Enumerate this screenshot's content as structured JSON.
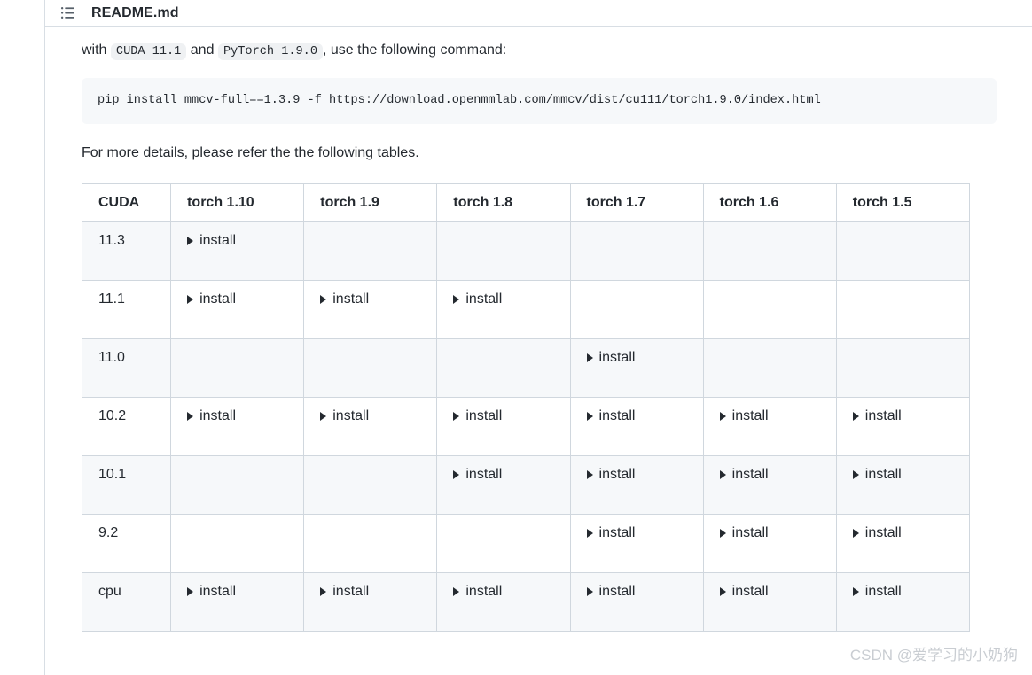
{
  "header": {
    "file_name": "README.md",
    "toc_icon": "list-unordered-icon"
  },
  "content": {
    "intro": {
      "prefix": "with",
      "code_1": "CUDA 11.1",
      "middle": "and",
      "code_2": "PyTorch 1.9.0",
      "suffix": ", use the following command:"
    },
    "command": "pip install mmcv-full==1.3.9 -f https://download.openmmlab.com/mmcv/dist/cu111/torch1.9.0/index.html",
    "details_note": "For more details, please refer the the following tables."
  },
  "table": {
    "headers": [
      "CUDA",
      "torch 1.10",
      "torch 1.9",
      "torch 1.8",
      "torch 1.7",
      "torch 1.6",
      "torch 1.5"
    ],
    "install_label": "install",
    "rows": [
      {
        "cuda": "11.3",
        "cells": [
          "install",
          "",
          "",
          "",
          "",
          ""
        ],
        "shaded": true
      },
      {
        "cuda": "11.1",
        "cells": [
          "install",
          "install",
          "install",
          "",
          "",
          ""
        ],
        "shaded": false
      },
      {
        "cuda": "11.0",
        "cells": [
          "",
          "",
          "",
          "install",
          "",
          ""
        ],
        "shaded": true
      },
      {
        "cuda": "10.2",
        "cells": [
          "install",
          "install",
          "install",
          "install",
          "install",
          "install"
        ],
        "shaded": false
      },
      {
        "cuda": "10.1",
        "cells": [
          "",
          "",
          "install",
          "install",
          "install",
          "install"
        ],
        "shaded": true
      },
      {
        "cuda": "9.2",
        "cells": [
          "",
          "",
          "",
          "install",
          "install",
          "install"
        ],
        "shaded": false
      },
      {
        "cuda": "cpu",
        "cells": [
          "install",
          "install",
          "install",
          "install",
          "install",
          "install"
        ],
        "shaded": true
      }
    ]
  },
  "watermark": {
    "text": "CSDN @爱学习的小奶狗"
  },
  "colors": {
    "page_background": "#ffffff",
    "text": "#24292f",
    "border": "#d0d7de",
    "header_border": "#d8dee4",
    "code_background": "#f6f8fa",
    "inline_code_background": "#eff1f3",
    "row_shade": "#f6f8fa",
    "watermark": "#c9cdd2"
  }
}
